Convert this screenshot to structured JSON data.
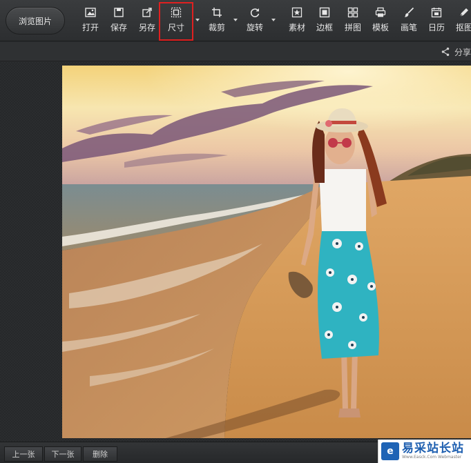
{
  "toolbar": {
    "browse_label": "浏览图片",
    "tools": [
      {
        "id": "open",
        "label": "打开",
        "icon": "open-image-icon"
      },
      {
        "id": "save",
        "label": "保存",
        "icon": "save-icon"
      },
      {
        "id": "saveas",
        "label": "另存",
        "icon": "save-as-icon"
      },
      {
        "id": "size",
        "label": "尺寸",
        "icon": "resize-icon",
        "selected": true
      },
      {
        "id": "crop",
        "label": "裁剪",
        "icon": "crop-icon"
      },
      {
        "id": "rotate",
        "label": "旋转",
        "icon": "rotate-icon"
      },
      {
        "id": "material",
        "label": "素材",
        "icon": "star-icon"
      },
      {
        "id": "border",
        "label": "边框",
        "icon": "border-icon"
      },
      {
        "id": "collage",
        "label": "拼图",
        "icon": "grid-icon"
      },
      {
        "id": "template",
        "label": "模板",
        "icon": "template-icon"
      },
      {
        "id": "brush",
        "label": "画笔",
        "icon": "brush-icon"
      },
      {
        "id": "calendar",
        "label": "日历",
        "icon": "calendar-icon"
      },
      {
        "id": "cutout",
        "label": "抠图",
        "icon": "pen-icon"
      }
    ],
    "highlight_color": "#e02020"
  },
  "subbar": {
    "share_label": "分享"
  },
  "canvas": {
    "image_description": "beach-photo"
  },
  "bottombar": {
    "prev_label": "上一张",
    "next_label": "下一张",
    "delete_label": "删除"
  },
  "watermark": {
    "title": "易采站长站",
    "url": "Www.Easck.Com Webmaster"
  }
}
